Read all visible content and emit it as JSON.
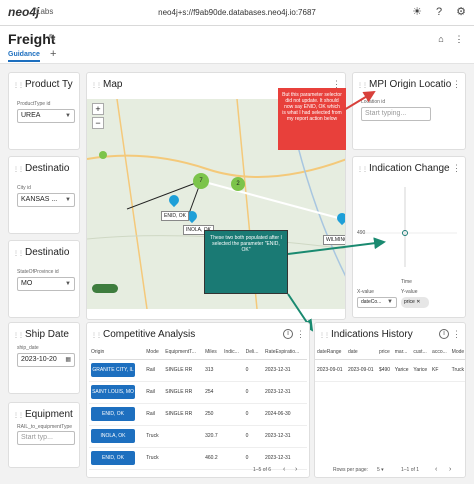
{
  "app": {
    "logo": "neo4j",
    "logo_sub": "Labs",
    "connection": "neo4j+s://f9ab90de.databases.neo4j.io:7687"
  },
  "dashboard": {
    "title": "Freight",
    "tabs": [
      {
        "label": "Guidance"
      }
    ]
  },
  "product_type": {
    "title": "Product Ty",
    "label": "ProductType id",
    "value": "UREA"
  },
  "destination_city": {
    "title": "Destinatio",
    "label": "City id",
    "value": "KANSAS ..."
  },
  "destination_state": {
    "title": "Destinatio",
    "label": "StateOfProvince id",
    "value": "MO"
  },
  "ship_date": {
    "title": "Ship Date",
    "label": "ship_date",
    "value": "2023-10-20"
  },
  "equipment": {
    "title": "Equipment",
    "label": "RAIL_to_equipmentType",
    "placeholder": "Start typ..."
  },
  "map": {
    "title": "Map",
    "cluster_a": "7",
    "cluster_b": "2",
    "tip_a": "ENID, OK",
    "tip_b": "INOLA, OK",
    "tip_c": "WILMINGTON",
    "annotation_red": "But this parameter selector did not update. It should now say ENID, OK which is what I had selected from my report action below",
    "annotation_teal": "These two both populated after I selected the parameter \"ENID, OK\""
  },
  "mpi_origin": {
    "title": "MPI Origin Locatio",
    "label": "Location id",
    "placeholder": "Start typing..."
  },
  "indication_change": {
    "title": "Indication Change",
    "y_value": "490",
    "x_axis_label": "Time",
    "x_value_label": "X-value",
    "y_value_label": "Y-value",
    "x_select": "dateCo...",
    "y_chip": "price"
  },
  "competitive": {
    "title": "Competitive Analysis",
    "columns": [
      "Origin",
      "Mode",
      "EquipmentT...",
      "Miles",
      "Indic...",
      "Deli...",
      "RateExpiratio..."
    ],
    "rows": [
      [
        "GRANITE CITY, IL",
        "Rail",
        "SINGLE RR",
        "313",
        "",
        "0",
        "2023-12-31"
      ],
      [
        "SAINT LOUIS, MO",
        "Rail",
        "SINGLE RR",
        "254",
        "",
        "0",
        "2023-12-31"
      ],
      [
        "ENID, OK",
        "Rail",
        "SINGLE RR",
        "250",
        "",
        "0",
        "2024-06-30"
      ],
      [
        "INOLA, OK",
        "Truck",
        "",
        "320.7",
        "",
        "0",
        "2023-12-31"
      ],
      [
        "ENID, OK",
        "Truck",
        "",
        "460.2",
        "",
        "0",
        "2023-12-31"
      ]
    ],
    "pagination": "1–5 of 6"
  },
  "indications_history": {
    "title": "Indications History",
    "columns": [
      "dateRange",
      "date",
      "price",
      "mar...",
      "cust...",
      "acco...",
      "Mode"
    ],
    "rows": [
      [
        "2023-09-01",
        "2023-09-01",
        "$490",
        "Yarice",
        "Yarice",
        "KF",
        "Truck"
      ]
    ],
    "rows_per_page_label": "Rows per page:",
    "rows_per_page": "5",
    "pagination": "1–1 of 1"
  },
  "colors": {
    "accent": "#1d6fbf",
    "red_note": "#e8403b",
    "teal_note": "#1a7a74",
    "cluster": "#7cc44a"
  }
}
